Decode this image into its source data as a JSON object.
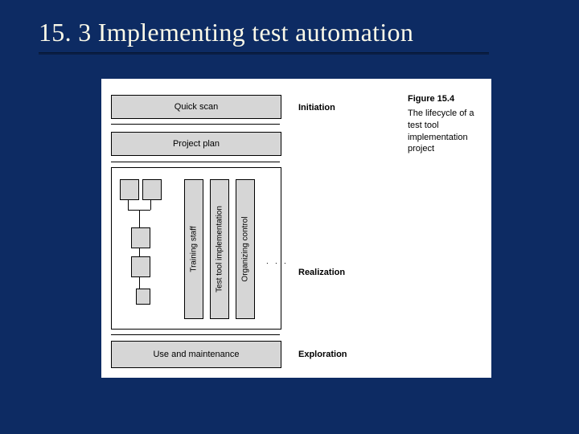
{
  "title": "15. 3 Implementing test automation",
  "figure": {
    "number": "Figure 15.4",
    "caption": "The lifecycle of a test tool implementation project"
  },
  "phases": {
    "initiation": "Initiation",
    "realization": "Realization",
    "exploration": "Exploration"
  },
  "bars": {
    "quick_scan": "Quick scan",
    "project_plan": "Project plan",
    "use_maintenance": "Use and maintenance"
  },
  "vertical_columns": {
    "c1": "Training staff",
    "c2": "Test tool implementation",
    "c3": "Organizing control",
    "more": ". . ."
  },
  "colors": {
    "slide_bg": "#0d2b63",
    "title_fg": "#fbf9e8",
    "box_fill": "#d6d6d6"
  }
}
